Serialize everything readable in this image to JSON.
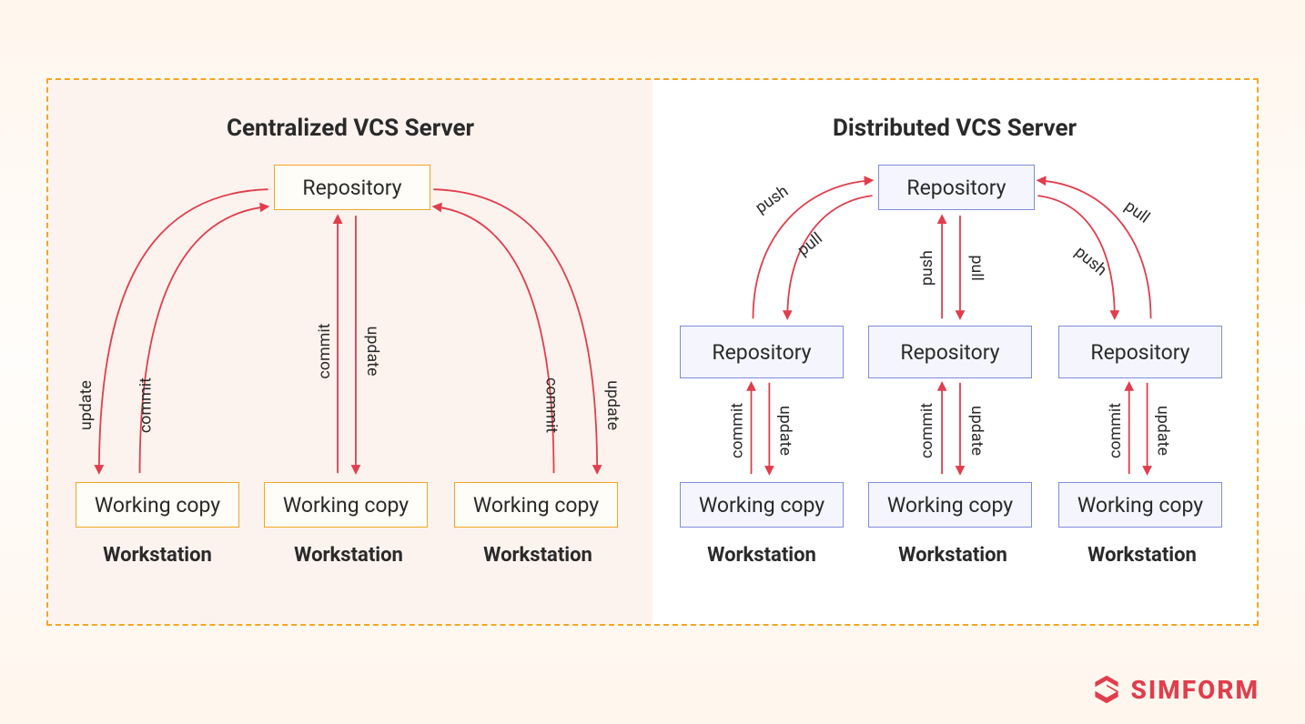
{
  "left": {
    "title": "Centralized VCS Server",
    "repo": "Repository",
    "wc": "Working copy",
    "ws": "Workstation",
    "commit": "commit",
    "update": "update"
  },
  "right": {
    "title": "Distributed VCS Server",
    "repo": "Repository",
    "wc": "Working copy",
    "ws": "Workstation",
    "push": "push",
    "pull": "pull",
    "commit": "commit",
    "update": "update"
  },
  "brand": "SIMFORM"
}
